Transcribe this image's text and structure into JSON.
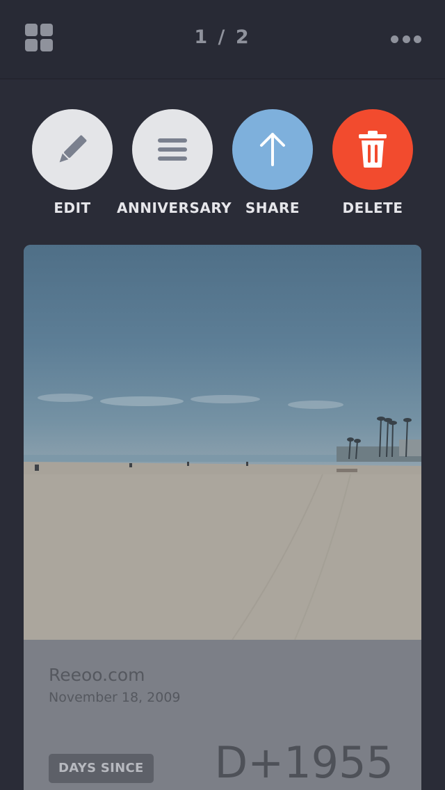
{
  "header": {
    "pager": "1 / 2",
    "left_icon": "grid-icon",
    "right_icon": "more-icon"
  },
  "actions": [
    {
      "label": "EDIT",
      "icon": "pencil-icon",
      "color": "#e4e5e8"
    },
    {
      "label": "ANNIVERSARY",
      "icon": "menu-lines-icon",
      "color": "#e4e5e8"
    },
    {
      "label": "SHARE",
      "icon": "arrow-up-icon",
      "color": "#7eb0dc"
    },
    {
      "label": "DELETE",
      "icon": "trash-icon",
      "color": "#f24b2e"
    }
  ],
  "card": {
    "title": "Reeoo.com",
    "date": "November 18, 2009",
    "badge": "DAYS SINCE",
    "count": "D+1955"
  }
}
